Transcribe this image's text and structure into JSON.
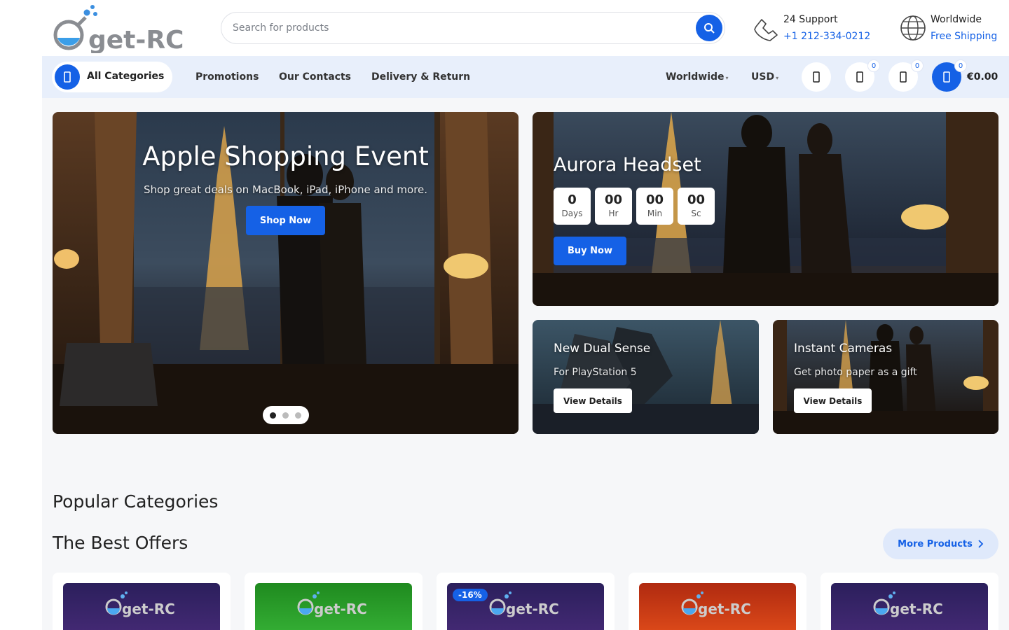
{
  "header": {
    "logo_text": "get-RC",
    "search_placeholder": "Search for products",
    "support": {
      "title": "24 Support",
      "phone": "+1 212-334-0212"
    },
    "shipping": {
      "title": "Worldwide",
      "subtitle": "Free Shipping"
    }
  },
  "nav": {
    "all_categories": "All Categories",
    "links": [
      "Promotions",
      "Our Contacts",
      "Delivery & Return"
    ],
    "region": "Worldwide",
    "currency": "USD",
    "wishlist_count": "0",
    "compare_count": "0",
    "cart_count": "0",
    "cart_total": "€0.00",
    "icons": [
      "user-icon",
      "heart-icon",
      "compare-icon",
      "cart-icon"
    ]
  },
  "hero": {
    "title": "Apple Shopping Event",
    "subtitle": "Shop great deals on MacBook, iPad, iPhone and more.",
    "button": "Shop Now",
    "slides": 3,
    "active_slide": 1
  },
  "promo_aurora": {
    "title": "Aurora Headset",
    "countdown": [
      {
        "value": "0",
        "unit": "Days"
      },
      {
        "value": "00",
        "unit": "Hr"
      },
      {
        "value": "00",
        "unit": "Min"
      },
      {
        "value": "00",
        "unit": "Sc"
      }
    ],
    "button": "Buy Now"
  },
  "promo_dualsense": {
    "title": "New Dual Sense",
    "subtitle": "For PlayStation 5",
    "button": "View Details"
  },
  "promo_cameras": {
    "title": "Instant Cameras",
    "subtitle": "Get photo paper as a gift",
    "button": "View Details"
  },
  "sections": {
    "popular_categories": "Popular Categories",
    "best_offers": "The Best Offers",
    "more_products": "More Products"
  },
  "products": [
    {
      "logo": "get-RC",
      "discount": ""
    },
    {
      "logo": "get-RC",
      "discount": ""
    },
    {
      "logo": "get-RC",
      "discount": "-16%"
    },
    {
      "logo": "get-RC",
      "discount": ""
    },
    {
      "logo": "get-RC",
      "discount": ""
    }
  ],
  "colors": {
    "accent": "#1561e6",
    "nav_bg": "#e8effb"
  }
}
